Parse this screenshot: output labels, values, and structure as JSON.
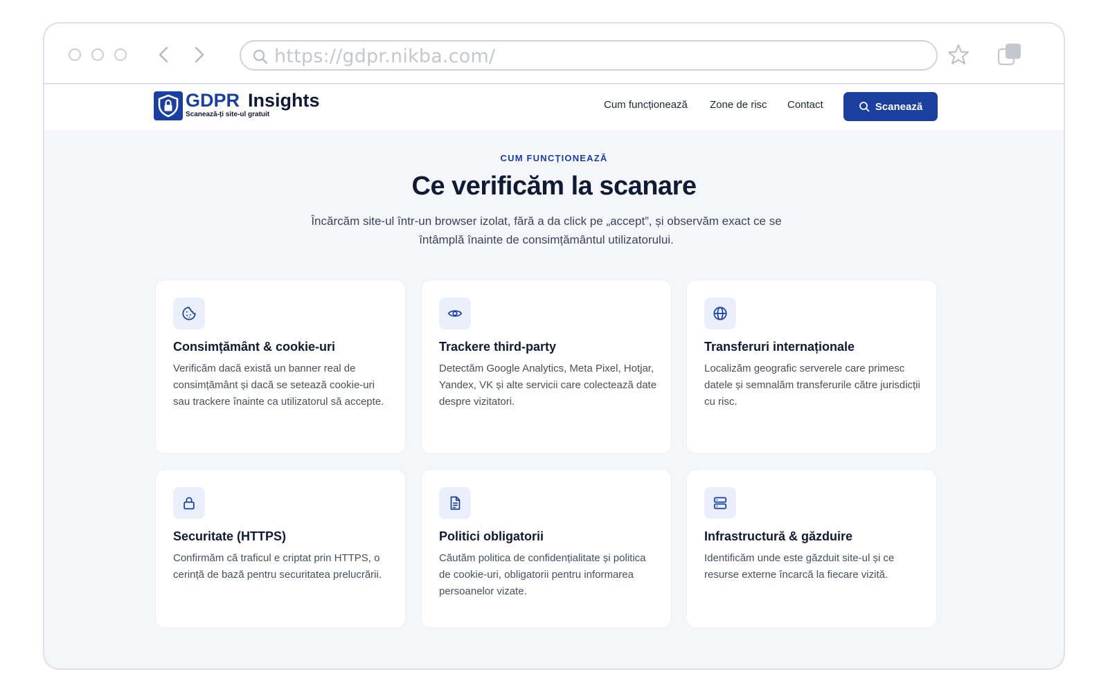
{
  "browser": {
    "url": "https://gdpr.nikba.com/"
  },
  "header": {
    "brand_part1": "GDPR",
    "brand_part2": "Insights",
    "tagline": "Scanează-ți site-ul gratuit",
    "nav": [
      {
        "label": "Cum funcționează"
      },
      {
        "label": "Zone de risc"
      },
      {
        "label": "Contact"
      }
    ],
    "cta_label": "Scanează"
  },
  "hero": {
    "eyebrow": "CUM FUNCȚIONEAZĂ",
    "title": "Ce verificăm la scanare",
    "lede": "Încărcăm site-ul într-un browser izolat, fără a da click pe „accept”, și observăm exact ce se întâmplă înainte de consimțământul utilizatorului."
  },
  "cards": [
    {
      "icon": "cookie-icon",
      "title": "Consimțământ & cookie-uri",
      "desc": "Verificăm dacă există un banner real de consimțământ și dacă se setează cookie-uri sau trackere înainte ca utilizatorul să accepte."
    },
    {
      "icon": "eye-icon",
      "title": "Trackere third-party",
      "desc": "Detectăm Google Analytics, Meta Pixel, Hotjar, Yandex, VK și alte servicii care colectează date despre vizitatori."
    },
    {
      "icon": "globe-icon",
      "title": "Transferuri internaționale",
      "desc": "Localizăm geografic serverele care primesc datele și semnalăm transferurile către jurisdicții cu risc."
    },
    {
      "icon": "lock-icon",
      "title": "Securitate (HTTPS)",
      "desc": "Confirmăm că traficul e criptat prin HTTPS, o cerință de bază pentru securitatea prelucrării."
    },
    {
      "icon": "document-icon",
      "title": "Politici obligatorii",
      "desc": "Căutăm politica de confidențialitate și politica de cookie-uri, obligatorii pentru informarea persoanelor vizate."
    },
    {
      "icon": "server-icon",
      "title": "Infrastructură & găzduire",
      "desc": "Identificăm unde este găzduit site-ul și ce resurse externe încarcă la fiecare vizită."
    }
  ],
  "colors": {
    "brand": "#1b3f9e",
    "heading": "#101a33",
    "icon_bg": "#eaf0fb",
    "page_bg": "#f4f6fa"
  }
}
